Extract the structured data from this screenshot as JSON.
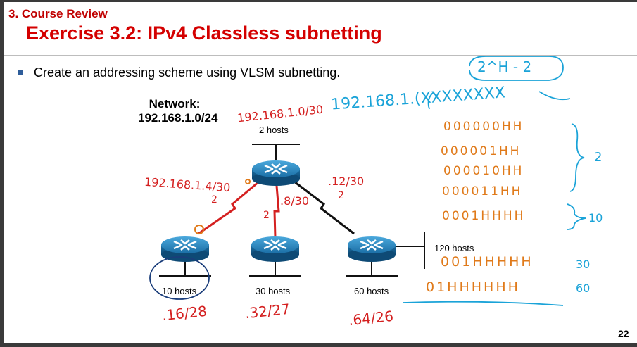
{
  "slide": {
    "section_title": "3. Course Review",
    "title": "Exercise 3.2: IPv4 Classless subnetting",
    "bullet": "Create an addressing scheme using VLSM subnetting.",
    "page_number": "22"
  },
  "diagram": {
    "network_label": "Network:",
    "network_address": "192.168.1.0/24",
    "hosts": {
      "top": "2 hosts",
      "r1": "10 hosts",
      "r2": "30 hosts",
      "r3": "60 hosts",
      "r4": "120 hosts"
    }
  },
  "annotations": {
    "top_link": "192.168.1.0/30",
    "left_link": "192.168.1.4/30",
    "middle_link": ".8/30",
    "right_link": ".12/30",
    "sub_r1": ".16/28",
    "sub_r2": ".32/27",
    "sub_r3": ".64/26",
    "formula": "2^H - 2",
    "octet_header": "192.168.1.(XXXXXXXX",
    "bit_rows": [
      "000000HH",
      "000001HH",
      "000010HH",
      "000011HH",
      "0001HHHH",
      "001HHHHH",
      "01HHHHHH"
    ],
    "brace_2": "2",
    "brace_10": "10",
    "brace_30": "30",
    "brace_60": "60",
    "twos": [
      "2",
      "2",
      "2"
    ]
  },
  "colors": {
    "title_red": "#d40000",
    "link_red": "#d42020",
    "router_blue": "#1f7fb5",
    "ink_red": "#d42020",
    "ink_orange": "#e07a1a",
    "ink_blue": "#1aa3d8"
  }
}
